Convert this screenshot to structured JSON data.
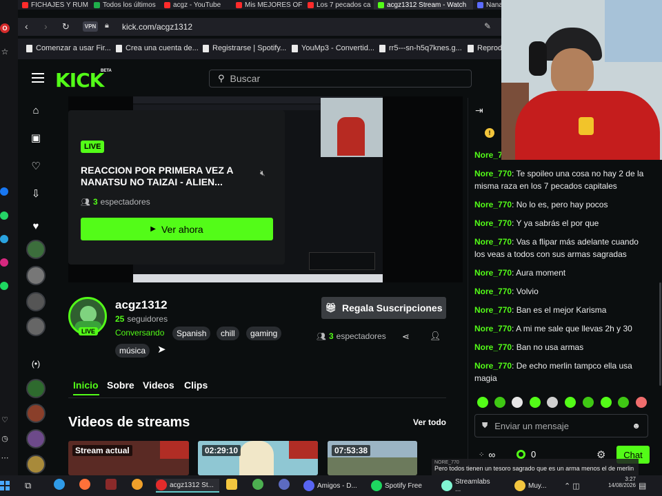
{
  "browser": {
    "tabs": [
      {
        "label": "FICHAJES Y RUM",
        "color": "#ff2b2b"
      },
      {
        "label": "Todos los últimos",
        "color": "#1fae4b"
      },
      {
        "label": "acgz - YouTube",
        "color": "#ff2b2b"
      },
      {
        "label": "Mis MEJORES OF",
        "color": "#ff2b2b"
      },
      {
        "label": "Los 7 pecados ca",
        "color": "#ff2b2b"
      },
      {
        "label": "acgz1312 Stream - Watch",
        "color": "#53fc18"
      },
      {
        "label": "Nana",
        "color": "#5b6bff"
      }
    ],
    "address": "kick.com/acgz1312",
    "vpn_label": "VPN",
    "bookmarks": [
      {
        "label": "Comenzar a usar Fir..."
      },
      {
        "label": "Crea una cuenta de..."
      },
      {
        "label": "Registrarse | Spotify..."
      },
      {
        "label": "YouMp3 - Convertid..."
      },
      {
        "label": "rr5---sn-h5q7knes.g..."
      },
      {
        "label": "Reprodu"
      }
    ]
  },
  "kick": {
    "logo": "KICK",
    "logo_badge": "BETA",
    "search_placeholder": "Buscar",
    "card": {
      "live_label": "LIVE",
      "title": "REACCION POR PRIMERA VEZ A NANATSU NO TAIZAI - ALIEN...",
      "viewers_count": "3",
      "viewers_label": "espectadores",
      "watch_label": "Ver ahora"
    },
    "channel": {
      "name": "acgz1312",
      "followers_count": "25",
      "followers_label": "seguidores",
      "live_label": "LIVE",
      "category": "Conversando",
      "tags": [
        "Spanish",
        "chill",
        "gaming",
        "música"
      ],
      "gift_label": "Regala Suscripciones",
      "viewers_count": "3",
      "viewers_label": "espectadores"
    },
    "tabs": [
      "Inicio",
      "Sobre",
      "Videos",
      "Clips"
    ],
    "videos": {
      "heading": "Videos de streams",
      "see_all": "Ver todo",
      "items": [
        {
          "label": "Stream actual"
        },
        {
          "label": "02:29:10"
        },
        {
          "label": "07:53:38"
        }
      ]
    },
    "colors": {
      "accent": "#53fc18",
      "bg": "#0b0e0f"
    }
  },
  "chat": {
    "top_user": "Nore_770",
    "messages": [
      {
        "user": "Nore_770",
        "text": "Te spoileo una cosa no hay 2 de la misma raza en los 7 pecados capitales"
      },
      {
        "user": "Nore_770",
        "text": "No lo es, pero hay pocos"
      },
      {
        "user": "Nore_770",
        "text": "Y ya sabrás el por que"
      },
      {
        "user": "Nore_770",
        "text": "Vas a flipar más adelante cuando los veas a todos con sus armas sagradas"
      },
      {
        "user": "Nore_770",
        "text": "Aura moment"
      },
      {
        "user": "Nore_770",
        "text": "Volvio"
      },
      {
        "user": "Nore_770",
        "text": "Ban es el mejor Karisma"
      },
      {
        "user": "Nore_770",
        "text": "A mi me sale que llevas 2h y 30"
      },
      {
        "user": "Nore_770",
        "text": "Ban no usa armas"
      },
      {
        "user": "Nore_770",
        "text": "De echo merlin tampco ella usa magia"
      }
    ],
    "input_placeholder": "Enviar un mensaje",
    "points_symbol": "∞",
    "coins": "0",
    "chat_button": "Chat"
  },
  "taskbar": {
    "items": [
      {
        "label": "acgz1312 St..."
      },
      {
        "label": "Amigos - D..."
      },
      {
        "label": "Spotify Free"
      },
      {
        "label": "Streamlabs ..."
      },
      {
        "label": "Muy..."
      }
    ],
    "time": "3:27",
    "date": "14/08/2026"
  },
  "toast": {
    "user": "NORE_770",
    "text": "Pero todos tienen un tesoro sagrado que es un arma menos el de merlin"
  }
}
